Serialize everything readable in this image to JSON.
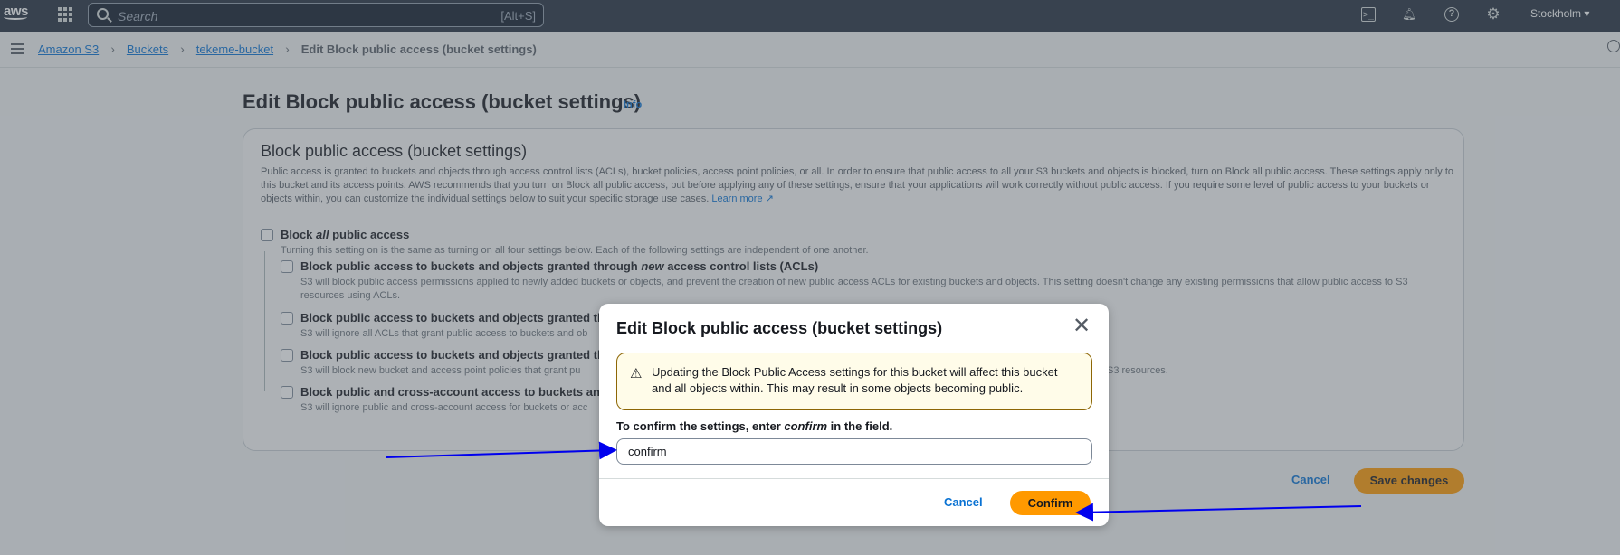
{
  "topnav": {
    "logo": "aws",
    "search_placeholder": "Search",
    "search_shortcut": "[Alt+S]",
    "region": "Stockholm ▾",
    "icons": [
      "services-grid-icon",
      "cloudshell-icon",
      "bell-icon",
      "help-icon",
      "gear-icon"
    ]
  },
  "breadcrumb": {
    "items": [
      "Amazon S3",
      "Buckets",
      "tekeme-bucket"
    ],
    "current": "Edit Block public access (bucket settings)"
  },
  "page": {
    "title": "Edit Block public access (bucket settings)",
    "info": "Info"
  },
  "container": {
    "title": "Block public access (bucket settings)",
    "description": "Public access is granted to buckets and objects through access control lists (ACLs), bucket policies, access point policies, or all. In order to ensure that public access to all your S3 buckets and objects is blocked, turn on Block all public access. These settings apply only to this bucket and its access points. AWS recommends that you turn on Block all public access, but before applying any of these settings, ensure that your applications will work correctly without public access. If you require some level of public access to your buckets or objects within, you can customize the individual settings below to suit your specific storage use cases.",
    "learn_more": "Learn more",
    "block_all": {
      "pre": "Block ",
      "em": "all",
      "post": " public access",
      "desc": "Turning this setting on is the same as turning on all four settings below. Each of the following settings are independent of one another."
    },
    "opt1": {
      "pre": "Block public access to buckets and objects granted through ",
      "em": "new",
      "post": " access control lists (ACLs)",
      "desc": "S3 will block public access permissions applied to newly added buckets or objects, and prevent the creation of new public access ACLs for existing buckets and objects. This setting doesn't change any existing permissions that allow public access to S3 resources using ACLs."
    },
    "opt2": {
      "title": "Block public access to buckets and objects granted th",
      "desc": "S3 will ignore all ACLs that grant public access to buckets and ob"
    },
    "opt3": {
      "title": "Block public access to buckets and objects granted th",
      "desc": "S3 will block new bucket and access point policies that grant pu",
      "desc_tail": "S3 resources."
    },
    "opt4": {
      "title": "Block public and cross-account access to buckets and",
      "desc": "S3 will ignore public and cross-account access for buckets or acc"
    }
  },
  "footer": {
    "cancel": "Cancel",
    "save": "Save changes"
  },
  "modal": {
    "title": "Edit Block public access (bucket settings)",
    "warning": "Updating the Block Public Access settings for this bucket will affect this bucket and all objects within. This may result in some objects becoming public.",
    "confirm_label_pre": "To confirm the settings, enter ",
    "confirm_label_em": "confirm",
    "confirm_label_post": " in the field.",
    "input_value": "confirm",
    "cancel": "Cancel",
    "confirm": "Confirm"
  },
  "colors": {
    "accent": "#ff9900",
    "link": "#0972d3",
    "annotation_arrow": "#0000ee"
  }
}
